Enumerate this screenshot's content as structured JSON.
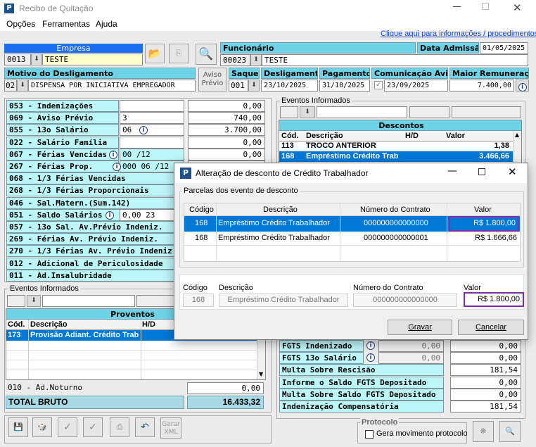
{
  "window": {
    "title": "Recibo de Quitação"
  },
  "menu": [
    "Opções",
    "Ferramentas",
    "Ajuda"
  ],
  "help_link": "Clique aqui para informações / procedimentos",
  "empresa": {
    "label": "Empresa",
    "code": "0013",
    "name": "TESTE"
  },
  "funcionario": {
    "label": "Funcionário",
    "code": "00023",
    "name": "TESTE"
  },
  "data_admissao": {
    "label": "Data Admissão:",
    "value": "01/05/2025"
  },
  "motivo": {
    "label": "Motivo do Desligamento",
    "code": "02",
    "value": "DISPENSA POR INICIATIVA EMPREGADOR"
  },
  "aviso_previo_btn": "Aviso\nPrévio",
  "saque": {
    "label": "Saque",
    "value": "001"
  },
  "desligamento": {
    "label": "Desligamento",
    "value": "23/10/2025"
  },
  "pagamento": {
    "label": "Pagamento",
    "value": "31/10/2025"
  },
  "comunicacao_aviso": {
    "label": "Comunicação Aviso",
    "value": "23/09/2025"
  },
  "maior_remuneracao": {
    "label": "Maior Remuneração",
    "value": "7.400,00"
  },
  "rubricas": [
    {
      "label": "053 - Indenizações",
      "extra": "",
      "value": "0,00"
    },
    {
      "label": "069 - Aviso Prévio",
      "extra": "3",
      "value": "740,00"
    },
    {
      "label": "055 - 13o Salário",
      "extra": "06",
      "value": "3.700,00"
    },
    {
      "label": "022 - Salário Família",
      "extra": "",
      "value": "0,00"
    },
    {
      "label": "067 - Férias Vencidas",
      "extra": "00 /12",
      "value": "0,00"
    },
    {
      "label": "267 - Férias Prop.",
      "extra": "000  06 /12",
      "value": "0,00"
    },
    {
      "label": "068 - 1/3 Férias Vencidas",
      "extra": "",
      "value": ""
    },
    {
      "label": "268 - 1/3 Férias Proporcionais",
      "extra": "",
      "value": ""
    },
    {
      "label": "046 - Sal.Matern.(Sum.142)",
      "extra": "",
      "value": ""
    },
    {
      "label": "051 - Saldo Salários",
      "extra": "0,00    23",
      "value": ""
    },
    {
      "label": "057 - 13o Sal. Av.Prévio Indeniz.",
      "extra": "",
      "value": ""
    },
    {
      "label": "269 - Férias  Av. Prévio Indeniz.",
      "extra": "",
      "value": ""
    },
    {
      "label": "270 - 1/3 Férias Av. Prévio Indeniz",
      "extra": "",
      "value": ""
    },
    {
      "label": "012 - Adicional de Periculosidade",
      "extra": "",
      "value": ""
    },
    {
      "label": "011 - Ad.Insalubridade",
      "extra": "",
      "value": ""
    }
  ],
  "eventos_left": {
    "label": "Eventos Informados"
  },
  "proventos": {
    "title": "Proventos",
    "cols": [
      "Cód.",
      "Descrição",
      "H/D"
    ],
    "rows": [
      {
        "cod": "173",
        "desc": "Provisão Adiant. Crédito Trab",
        "hd": ""
      }
    ]
  },
  "ad_noturno": {
    "label": "010 - Ad.Noturno",
    "value": "0,00"
  },
  "total_bruto": {
    "label": "TOTAL BRUTO",
    "value": "16.433,32"
  },
  "eventos_right": {
    "label": "Eventos Informados"
  },
  "descontos": {
    "title": "Descontos",
    "cols": [
      "Cód.",
      "Descrição",
      "H/D",
      "Valor"
    ],
    "rows": [
      {
        "cod": "113",
        "desc": "TROCO ANTERIOR",
        "hd": "",
        "valor": "1,38"
      },
      {
        "cod": "168",
        "desc": "Empréstimo Crédito Trab",
        "hd": "",
        "valor": "3.466,66"
      }
    ]
  },
  "fgts": [
    {
      "label": "FGTS Indenizado",
      "value": "0,00",
      "value2": "0,00"
    },
    {
      "label": "FGTS 13o Salário",
      "value": "0,00",
      "value2": "0,00"
    },
    {
      "label": "Multa Sobre Rescisão",
      "value": "",
      "value2": "181,54"
    },
    {
      "label": "Informe o Saldo FGTS Depositado",
      "value": "",
      "value2": "0,00"
    },
    {
      "label": "Multa Sobre Saldo FGTS Depositado",
      "value": "",
      "value2": "0,00"
    },
    {
      "label": "Indenização Compensatória",
      "value": "",
      "value2": "181,54"
    }
  ],
  "toolbar_bottom": {
    "gerar_xml": "Gerar\nXML"
  },
  "protocolo": {
    "label": "Protocolo",
    "checkbox": "Gera movimento protocolo"
  },
  "dialog": {
    "title": "Alteração de desconto de Crédito Trabalhador",
    "group": "Parcelas dos evento de desconto",
    "cols": [
      "Código",
      "Descrição",
      "Número do Contrato",
      "Valor"
    ],
    "rows": [
      {
        "codigo": "168",
        "descricao": "Empréstimo Crédito Trabalhador",
        "contrato": "000000000000000",
        "valor": "R$ 1.800,00"
      },
      {
        "codigo": "168",
        "descricao": "Empréstimo Crédito Trabalhador",
        "contrato": "000000000000001",
        "valor": "R$ 1.666,66"
      }
    ],
    "edit": {
      "codigo_label": "Código",
      "descricao_label": "Descrição",
      "contrato_label": "Número do Contrato",
      "valor_label": "Valor",
      "codigo": "168",
      "descricao": "Empréstimo Crédito Trabalhador",
      "contrato": "000000000000000",
      "valor": "R$ 1.800,00"
    },
    "gravar": "Gravar",
    "cancelar": "Cancelar"
  }
}
